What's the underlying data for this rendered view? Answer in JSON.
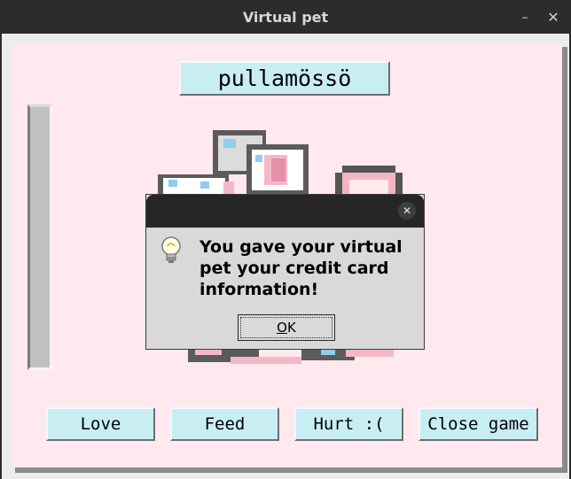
{
  "window": {
    "title": "Virtual pet",
    "minimize_glyph": "–",
    "close_glyph": "✕"
  },
  "pet": {
    "name": "pullamössö"
  },
  "buttons": {
    "love": "Love",
    "feed": "Feed",
    "hurt": "Hurt :(",
    "close_game": "Close game"
  },
  "dialog": {
    "icon": "lightbulb-icon",
    "close_glyph": "✕",
    "message": "You gave your virtual pet your credit card information!",
    "ok_mnemonic": "O",
    "ok_rest": "K"
  },
  "colors": {
    "background_pink": "#ffe9ee",
    "button_cyan": "#c8eef4",
    "titlebar": "#2c2c2c",
    "dialog_bg": "#d9d9d9"
  }
}
